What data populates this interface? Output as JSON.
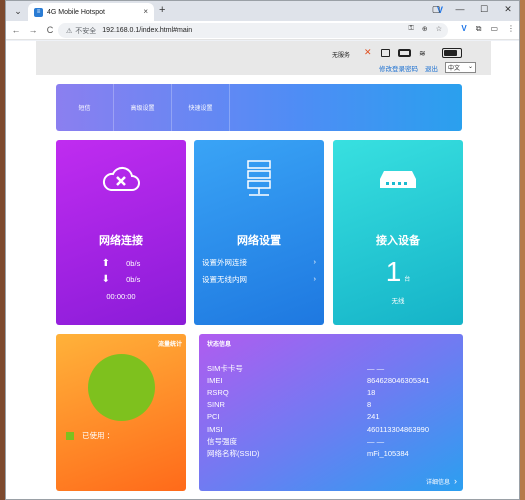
{
  "browser": {
    "tab_title": "4G Mobile Hotspot",
    "url": "192.168.0.1/index.html#main",
    "insecure_label": "不安全",
    "new_tab": "+",
    "tab_close": "×"
  },
  "header": {
    "service_status": "无服务",
    "change_password": "修改登录密码",
    "logout": "退出",
    "language": "中文"
  },
  "menu": [
    {
      "label": "短信"
    },
    {
      "label": "高级设置"
    },
    {
      "label": "快速设置"
    }
  ],
  "network_card": {
    "title": "网络连接",
    "upload": "0b/s",
    "download": "0b/s",
    "duration": "00:00:00"
  },
  "settings_card": {
    "title": "网络设置",
    "links": [
      "设置外网连接",
      "设置无线内网"
    ]
  },
  "device_card": {
    "title": "接入设备",
    "count": "1",
    "unit": "台",
    "sub": "无线"
  },
  "flow_card": {
    "title": "流量统计",
    "legend": "已使用 ："
  },
  "status_card": {
    "title": "状态信息",
    "rows": [
      {
        "k": "SIM卡卡号",
        "v": "— —"
      },
      {
        "k": "IMEI",
        "v": "864628046305341"
      },
      {
        "k": "RSRQ",
        "v": "18"
      },
      {
        "k": "SINR",
        "v": "8"
      },
      {
        "k": "PCI",
        "v": "241"
      },
      {
        "k": "IMSI",
        "v": "460113304863990"
      },
      {
        "k": "信号强度",
        "v": "— —"
      },
      {
        "k": "网络名称(SSID)",
        "v": "mFi_105384"
      }
    ],
    "more": "详细信息"
  },
  "colors": {
    "network": "#a424e8",
    "settings": "#2a8aee",
    "devices": "#22c6d2",
    "flow": "#ff8a2a",
    "flow_used": "#7ec11e",
    "link": "#1a6fd1"
  }
}
